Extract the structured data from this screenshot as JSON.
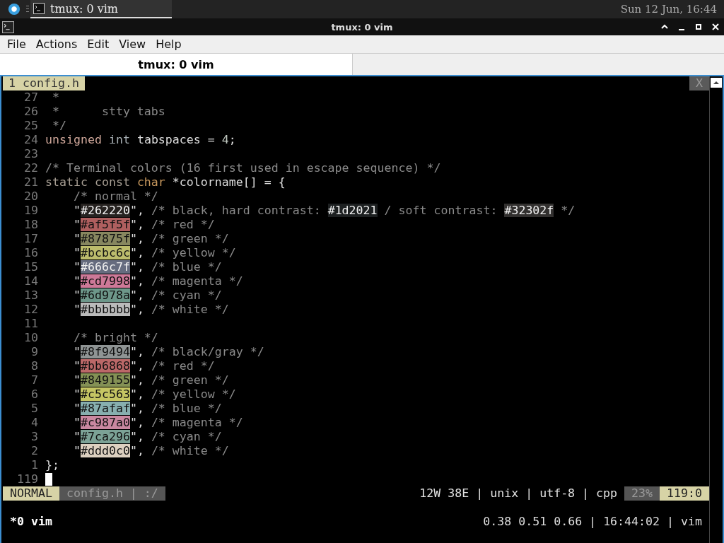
{
  "taskbar": {
    "window_button": {
      "label": "tmux: 0 vim",
      "selected": true
    },
    "clock": "Sun 12 Jun, 16:44"
  },
  "window": {
    "title": "tmux: 0 vim"
  },
  "menu": [
    "File",
    "Actions",
    "Edit",
    "View",
    "Help"
  ],
  "tabs": [
    {
      "label": "tmux: 0 vim",
      "selected": true
    }
  ],
  "vim": {
    "tabline": {
      "tabs": [
        {
          "label": "1 config.h",
          "selected": true
        }
      ],
      "close": "X"
    },
    "lines": [
      {
        "number": "27",
        "segments": [
          {
            "kind": "comment",
            "text": " *"
          }
        ]
      },
      {
        "number": "26",
        "segments": [
          {
            "kind": "comment",
            "text": " *      stty tabs"
          }
        ]
      },
      {
        "number": "25",
        "segments": [
          {
            "kind": "comment",
            "text": " */"
          }
        ]
      },
      {
        "number": "24",
        "segments": [
          {
            "kind": "keyword",
            "text": "unsigned"
          },
          {
            "kind": "builtin",
            "text": " int"
          },
          {
            "kind": "plain",
            "text": " tabspaces = "
          },
          {
            "kind": "number",
            "text": "4"
          },
          {
            "kind": "plain",
            "text": ";"
          }
        ]
      },
      {
        "number": "23"
      },
      {
        "number": "22",
        "segments": [
          {
            "kind": "comment",
            "text": "/* Terminal colors (16 first used in escape sequence) */"
          }
        ]
      },
      {
        "number": "21",
        "segments": [
          {
            "kind": "storage",
            "text": "static const "
          },
          {
            "kind": "type",
            "text": "char"
          },
          {
            "kind": "plain",
            "text": " *colorname[] = {"
          }
        ]
      },
      {
        "number": "20",
        "segments": [
          {
            "kind": "comment",
            "text": "    /* normal */"
          }
        ]
      },
      {
        "number": "19",
        "segments": [
          {
            "kind": "plain",
            "text": "    \""
          },
          {
            "kind": "swatch",
            "text": "#262220",
            "color": "#262220"
          },
          {
            "kind": "plain",
            "text": "\", "
          },
          {
            "kind": "comment",
            "text": "/* black, hard contrast: "
          },
          {
            "kind": "swatch",
            "text": "#1d2021",
            "color": "#1d2021"
          },
          {
            "kind": "comment",
            "text": " / soft contrast: "
          },
          {
            "kind": "swatch",
            "text": "#32302f",
            "color": "#32302f"
          },
          {
            "kind": "comment",
            "text": " */"
          }
        ]
      },
      {
        "number": "18",
        "segments": [
          {
            "kind": "plain",
            "text": "    \""
          },
          {
            "kind": "swatch",
            "text": "#af5f5f",
            "color": "#af5f5f"
          },
          {
            "kind": "plain",
            "text": "\", "
          },
          {
            "kind": "comment",
            "text": "/* red */"
          }
        ]
      },
      {
        "number": "17",
        "segments": [
          {
            "kind": "plain",
            "text": "    \""
          },
          {
            "kind": "swatch",
            "text": "#87875f",
            "color": "#87875f"
          },
          {
            "kind": "plain",
            "text": "\", "
          },
          {
            "kind": "comment",
            "text": "/* green */"
          }
        ]
      },
      {
        "number": "16",
        "segments": [
          {
            "kind": "plain",
            "text": "    \""
          },
          {
            "kind": "swatch",
            "text": "#bcbc6c",
            "color": "#bcbc6c"
          },
          {
            "kind": "plain",
            "text": "\", "
          },
          {
            "kind": "comment",
            "text": "/* yellow */"
          }
        ]
      },
      {
        "number": "15",
        "segments": [
          {
            "kind": "plain",
            "text": "    \""
          },
          {
            "kind": "swatch",
            "text": "#666c7f",
            "color": "#666c7f"
          },
          {
            "kind": "plain",
            "text": "\", "
          },
          {
            "kind": "comment",
            "text": "/* blue */"
          }
        ]
      },
      {
        "number": "14",
        "segments": [
          {
            "kind": "plain",
            "text": "    \""
          },
          {
            "kind": "swatch",
            "text": "#cd7998",
            "color": "#cd7998"
          },
          {
            "kind": "plain",
            "text": "\", "
          },
          {
            "kind": "comment",
            "text": "/* magenta */"
          }
        ]
      },
      {
        "number": "13",
        "segments": [
          {
            "kind": "plain",
            "text": "    \""
          },
          {
            "kind": "swatch",
            "text": "#6d978a",
            "color": "#6d978a"
          },
          {
            "kind": "plain",
            "text": "\", "
          },
          {
            "kind": "comment",
            "text": "/* cyan */"
          }
        ]
      },
      {
        "number": "12",
        "segments": [
          {
            "kind": "plain",
            "text": "    \""
          },
          {
            "kind": "swatch",
            "text": "#bbbbbb",
            "color": "#bbbbbb"
          },
          {
            "kind": "plain",
            "text": "\", "
          },
          {
            "kind": "comment",
            "text": "/* white */"
          }
        ]
      },
      {
        "number": "11"
      },
      {
        "number": "10",
        "segments": [
          {
            "kind": "comment",
            "text": "    /* bright */"
          }
        ]
      },
      {
        "number": "9",
        "segments": [
          {
            "kind": "plain",
            "text": "    \""
          },
          {
            "kind": "swatch",
            "text": "#8f9494",
            "color": "#8f9494"
          },
          {
            "kind": "plain",
            "text": "\", "
          },
          {
            "kind": "comment",
            "text": "/* black/gray */"
          }
        ]
      },
      {
        "number": "8",
        "segments": [
          {
            "kind": "plain",
            "text": "    \""
          },
          {
            "kind": "swatch",
            "text": "#bb6868",
            "color": "#bb6868"
          },
          {
            "kind": "plain",
            "text": "\", "
          },
          {
            "kind": "comment",
            "text": "/* red */"
          }
        ]
      },
      {
        "number": "7",
        "segments": [
          {
            "kind": "plain",
            "text": "    \""
          },
          {
            "kind": "swatch",
            "text": "#849155",
            "color": "#849155"
          },
          {
            "kind": "plain",
            "text": "\", "
          },
          {
            "kind": "comment",
            "text": "/* green */"
          }
        ]
      },
      {
        "number": "6",
        "segments": [
          {
            "kind": "plain",
            "text": "    \""
          },
          {
            "kind": "swatch",
            "text": "#c5c563",
            "color": "#c5c563"
          },
          {
            "kind": "plain",
            "text": "\", "
          },
          {
            "kind": "comment",
            "text": "/* yellow */"
          }
        ]
      },
      {
        "number": "5",
        "segments": [
          {
            "kind": "plain",
            "text": "    \""
          },
          {
            "kind": "swatch",
            "text": "#87afaf",
            "color": "#87afaf"
          },
          {
            "kind": "plain",
            "text": "\", "
          },
          {
            "kind": "comment",
            "text": "/* blue */"
          }
        ]
      },
      {
        "number": "4",
        "segments": [
          {
            "kind": "plain",
            "text": "    \""
          },
          {
            "kind": "swatch",
            "text": "#c987a0",
            "color": "#c987a0"
          },
          {
            "kind": "plain",
            "text": "\", "
          },
          {
            "kind": "comment",
            "text": "/* magenta */"
          }
        ]
      },
      {
        "number": "3",
        "segments": [
          {
            "kind": "plain",
            "text": "    \""
          },
          {
            "kind": "swatch",
            "text": "#7ca296",
            "color": "#7ca296"
          },
          {
            "kind": "plain",
            "text": "\", "
          },
          {
            "kind": "comment",
            "text": "/* cyan */"
          }
        ]
      },
      {
        "number": "2",
        "segments": [
          {
            "kind": "plain",
            "text": "    \""
          },
          {
            "kind": "swatch",
            "text": "#ddd0c0",
            "color": "#ddd0c0"
          },
          {
            "kind": "plain",
            "text": "\", "
          },
          {
            "kind": "comment",
            "text": "/* white */"
          }
        ]
      },
      {
        "number": "1",
        "segments": [
          {
            "kind": "plain",
            "text": "};"
          }
        ]
      },
      {
        "number": "119",
        "cursor": true
      }
    ],
    "statusline": {
      "mode": "NORMAL",
      "file": "config.h | :/",
      "info": "12W 38E | unix | utf-8 | cpp",
      "percent": "23%",
      "position": "119:0"
    }
  },
  "tmux": {
    "windows": "*0 vim",
    "status": "0.38 0.51 0.66 | 16:44:02 | vim"
  }
}
